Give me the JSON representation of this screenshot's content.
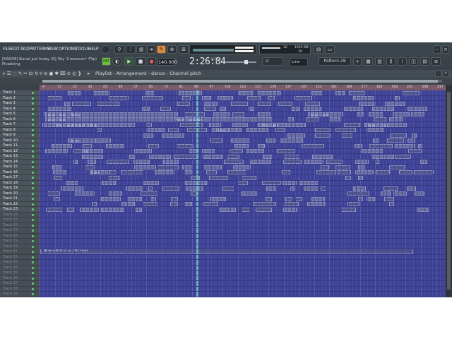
{
  "menu": [
    "FILE",
    "EDIT",
    "ADD",
    "PATTERNS",
    "VIEW",
    "OPTIONS",
    "TOOLS",
    "HELP"
  ],
  "song": {
    "title": "[NS009] Bunal Jud Inday (DJ Sky 'Crossover' Flip)",
    "status": "Finalizing"
  },
  "transport": {
    "bpm": "140.000",
    "time": "2:26:84",
    "time_label": "M:S:CS",
    "cpu": "32",
    "mem": "1935 MB",
    "voices": "10",
    "snap": "Line",
    "pattern": "Pattern 28"
  },
  "breadcrumb": "Playlist - Arrangement - dance - Channel pitch",
  "ruler_numbers": [
    "9",
    "17",
    "25",
    "33",
    "41",
    "49",
    "57",
    "65",
    "73",
    "81",
    "89",
    "97",
    "105",
    "113",
    "121",
    "129",
    "137",
    "145",
    "153",
    "161",
    "169",
    "177",
    "185",
    "193",
    "201",
    "209",
    "217"
  ],
  "tracks": [
    "Track 1",
    "Track 2",
    "Track 3",
    "Track 4",
    "Track 5",
    "Track 6",
    "Track 7",
    "Track 8",
    "Track 9",
    "Track 10",
    "Track 11",
    "Track 12",
    "Track 13",
    "Track 14",
    "Track 15",
    "Track 16",
    "Track 17",
    "Track 18",
    "Track 19",
    "Track 20",
    "Track 21",
    "Track 22",
    "Track 23",
    "Track 24",
    "Track 25",
    "Track 26",
    "Track 27",
    "Track 28",
    "Track 29",
    "Track 30",
    "Track 31",
    "Track 32",
    "Track 33",
    "Track 34",
    "Track 35",
    "Track 36",
    "Track 37",
    "Track 38",
    "Track 39"
  ],
  "automation_clip": "dBlue Glitch v1.3 - Mix level",
  "clip_labels": [
    "Vocals - Spot... - Sdtmp",
    "Vocals - Spot",
    "Vocals - SpotDown...",
    "Other - Spotlite Spot - Sdtmp",
    "Vocals - Spot",
    "Vocals - 5_map",
    "Bass - 2",
    "Drums",
    "Other - Spot",
    "VS.2",
    "Other"
  ],
  "colors": {
    "grid": "#3f4396",
    "clip": "#6a6fa0",
    "playhead": "#7fd9cf",
    "ruler": "#7a5b6a",
    "led": "#5dcc6b"
  }
}
